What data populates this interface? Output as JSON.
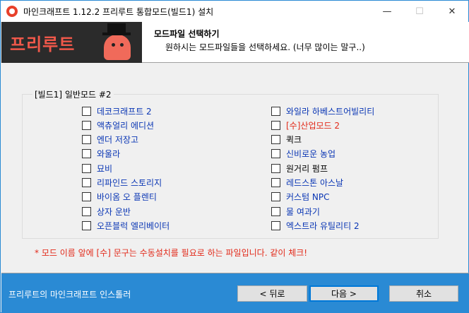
{
  "window": {
    "title": "마인크래프트 1.12.2 프리루트 통합모드(빌드1) 설치",
    "minimize": "—",
    "maximize": "☐",
    "close": "✕"
  },
  "header": {
    "banner_text": "프리루트",
    "title": "모드파일 선택하기",
    "subtitle": "원하시는 모드파일들을 선택하세요. (너무 많이는 말구..)"
  },
  "group": {
    "legend": "[빌드1] 일반모드 #2",
    "left_items": [
      {
        "label": "데코크래프트 2",
        "color": "blue",
        "checked": false
      },
      {
        "label": "액츄얼리 에디션",
        "color": "blue",
        "checked": false
      },
      {
        "label": "엔더 저장고",
        "color": "blue",
        "checked": false
      },
      {
        "label": "와울라",
        "color": "blue",
        "checked": false
      },
      {
        "label": "묘비",
        "color": "blue",
        "checked": false
      },
      {
        "label": "리파인드 스토리지",
        "color": "blue",
        "checked": false
      },
      {
        "label": "바이옴 오 플렌티",
        "color": "blue",
        "checked": false
      },
      {
        "label": "상자 운반",
        "color": "blue",
        "checked": false
      },
      {
        "label": "오픈블럭 엘리베이터",
        "color": "blue",
        "checked": false
      }
    ],
    "right_items": [
      {
        "label": "와일라 하베스트어빌리티",
        "color": "blue",
        "checked": false
      },
      {
        "label": "[수]산업모드 2",
        "color": "red",
        "checked": false
      },
      {
        "label": "퀵크",
        "color": "black",
        "checked": false
      },
      {
        "label": "신비로운 농업",
        "color": "blue",
        "checked": false
      },
      {
        "label": "원거리 펌프",
        "color": "black",
        "checked": false
      },
      {
        "label": "레드스톤 아스날",
        "color": "blue",
        "checked": false
      },
      {
        "label": "커스텀 NPC",
        "color": "blue",
        "checked": false
      },
      {
        "label": "물 여과기",
        "color": "blue",
        "checked": false
      },
      {
        "label": "엑스트라 유틸리티 2",
        "color": "blue",
        "checked": false
      }
    ]
  },
  "notice": "* 모드 이름 앞에 [수] 문구는 수동설치를 필요로 하는 파일입니다. 같이 체크!",
  "footer": {
    "brand": "프리루트의 마인크래프트 인스톨러",
    "back_label": "< 뒤로",
    "next_label": "다음 >",
    "cancel_label": "취소"
  },
  "colors": {
    "accent": "#2a8ad4",
    "link_blue": "#0a36b4",
    "warning_red": "#e22a1a",
    "banner_bg": "#2b2b2b",
    "banner_text": "#f0584a"
  }
}
